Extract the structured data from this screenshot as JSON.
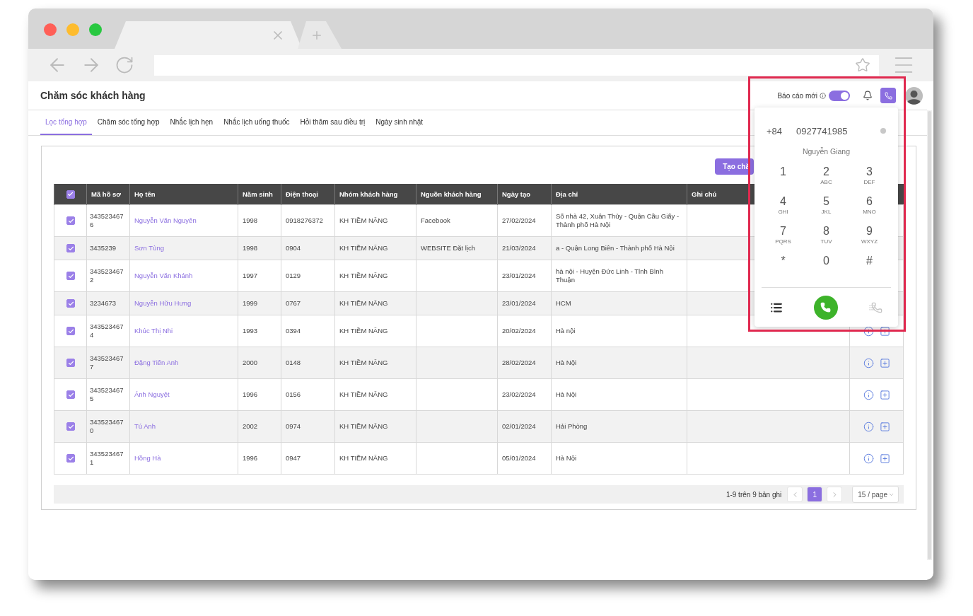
{
  "page": {
    "title": "Chăm sóc khách hàng"
  },
  "header": {
    "report_label": "Báo cáo mới",
    "report_toggle_on": true,
    "phone_active": true
  },
  "tabs": [
    {
      "label": "Lọc tổng hợp",
      "selected": true
    },
    {
      "label": "Chăm sóc tổng hợp",
      "selected": false
    },
    {
      "label": "Nhắc lịch hẹn",
      "selected": false
    },
    {
      "label": "Nhắc lịch uống thuốc",
      "selected": false
    },
    {
      "label": "Hỏi thăm sau điều trị",
      "selected": false
    },
    {
      "label": "Ngày sinh nhật",
      "selected": false
    }
  ],
  "create_button": "Tạo chă",
  "table": {
    "select_all_checked": true,
    "columns": [
      "Mã hồ sơ",
      "Họ tên",
      "Năm sinh",
      "Điện thoại",
      "Nhóm khách hàng",
      "Nguồn khách hàng",
      "Ngày tạo",
      "Địa chỉ",
      "Ghi chú"
    ],
    "rows": [
      {
        "checked": true,
        "actions_shown": false,
        "id": "3435234676",
        "name": "Nguyễn Văn Nguyên",
        "birth_year": "1998",
        "phone": "0918276372",
        "group": "KH TIỀM NĂNG",
        "source": "Facebook",
        "created": "27/02/2024",
        "address": "Số nhà 42, Xuân Thủy - Quận Cầu Giấy - Thành phố Hà Nội"
      },
      {
        "checked": true,
        "actions_shown": false,
        "id": "3435239",
        "name": "Sơn Tùng",
        "birth_year": "1998",
        "phone": "0904",
        "group": "KH TIỀM NĂNG",
        "source": "WEBSITE Đặt lịch",
        "created": "21/03/2024",
        "address": "a - Quận Long Biên - Thành phố Hà Nội"
      },
      {
        "checked": true,
        "actions_shown": false,
        "id": "3435234672",
        "name": "Nguyễn Văn Khánh",
        "birth_year": "1997",
        "phone": "0129",
        "group": "KH TIỀM NĂNG",
        "created": "23/01/2024",
        "address": "hà nội - Huyện Đức Linh - Tỉnh Bình Thuận"
      },
      {
        "checked": true,
        "actions_shown": false,
        "id": "3234673",
        "name": "Nguyễn Hữu Hưng",
        "birth_year": "1999",
        "phone": "0767",
        "group": "KH TIỀM NĂNG",
        "created": "23/01/2024",
        "address": "HCM"
      },
      {
        "checked": true,
        "actions_shown": true,
        "id": "3435234674",
        "name": "Khúc Thị Nhi",
        "birth_year": "1993",
        "phone": "0394",
        "group": "KH TIỀM NĂNG",
        "created": "20/02/2024",
        "address": "Hà nội"
      },
      {
        "checked": true,
        "actions_shown": true,
        "id": "3435234677",
        "name": "Đặng Tiến Anh",
        "birth_year": "2000",
        "phone": "0148",
        "group": "KH TIỀM NĂNG",
        "created": "28/02/2024",
        "address": "Hà Nội"
      },
      {
        "checked": true,
        "actions_shown": true,
        "id": "3435234675",
        "name": "Ánh Nguyệt",
        "birth_year": "1996",
        "phone": "0156",
        "group": "KH TIỀM NĂNG",
        "created": "23/02/2024",
        "address": "Hà Nội"
      },
      {
        "checked": true,
        "actions_shown": true,
        "id": "3435234670",
        "name": "Tú Anh",
        "birth_year": "2002",
        "phone": "0974",
        "group": "KH TIỀM NĂNG",
        "created": "02/01/2024",
        "address": "Hải Phòng"
      },
      {
        "checked": true,
        "actions_shown": true,
        "id": "3435234671",
        "name": "Hồng Hà",
        "birth_year": "1996",
        "phone": "0947",
        "group": "KH TIỀM NĂNG",
        "created": "05/01/2024",
        "address": "Hà Nội"
      }
    ]
  },
  "pagination": {
    "summary": "1-9 trên 9 bản ghi",
    "pages": [
      {
        "label": "1",
        "selected": true
      }
    ],
    "page_size": "15 / page"
  },
  "dialer": {
    "country_code": "+84",
    "number": "0927741985",
    "contact_name": "Nguyễn Giang",
    "keys": [
      {
        "digit": "1"
      },
      {
        "digit": "2",
        "letters": "ABC"
      },
      {
        "digit": "3",
        "letters": "DEF"
      },
      {
        "digit": "4",
        "letters": "GHI"
      },
      {
        "digit": "5",
        "letters": "JKL"
      },
      {
        "digit": "6",
        "letters": "MNO"
      },
      {
        "digit": "7",
        "letters": "PQRS"
      },
      {
        "digit": "8",
        "letters": "TUV"
      },
      {
        "digit": "9",
        "letters": "WXYZ"
      },
      {
        "digit": "*"
      },
      {
        "digit": "0"
      },
      {
        "digit": "#"
      }
    ]
  }
}
